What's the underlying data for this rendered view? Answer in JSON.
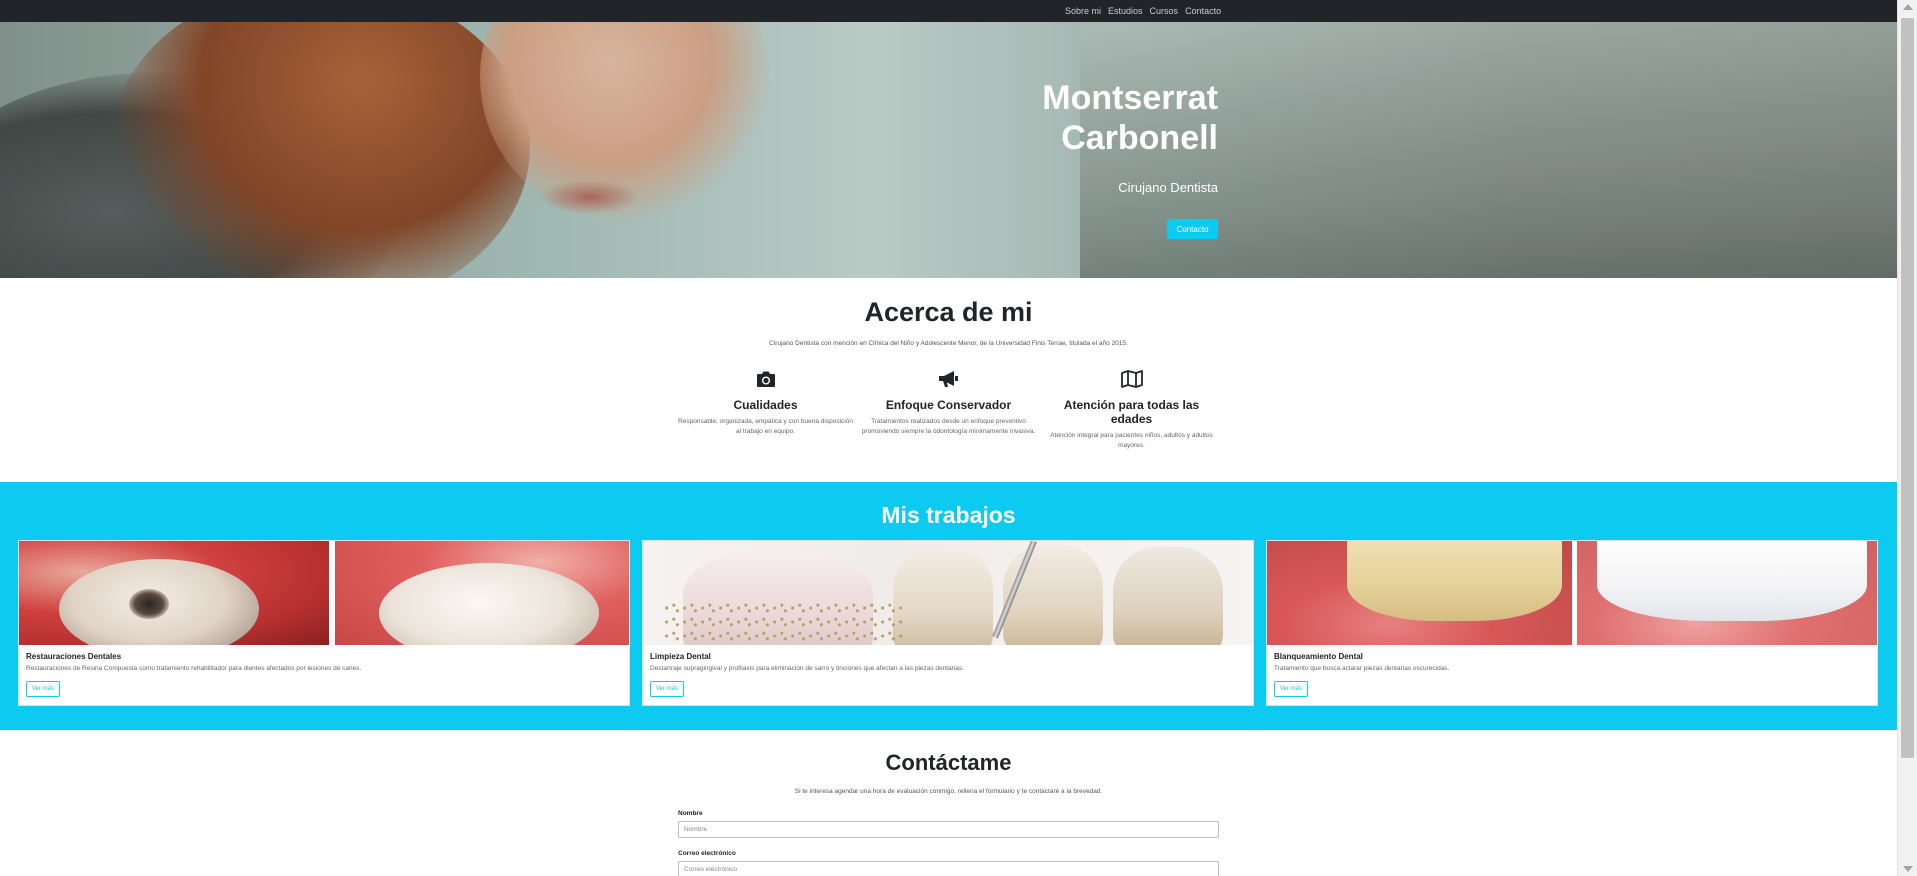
{
  "nav": {
    "items": [
      {
        "label": "Sobre mi"
      },
      {
        "label": "Estudios"
      },
      {
        "label": "Cursos"
      },
      {
        "label": "Contacto"
      }
    ]
  },
  "hero": {
    "name_line1": "Montserrat",
    "name_line2": "Carbonell",
    "role": "Cirujano Dentista",
    "button": "Contacto"
  },
  "about": {
    "title": "Acerca de mi",
    "intro": "Cirujano Dentista con mención en Clínica del Niño y Adolescente Menor, de la Universidad Finis Terrae, titulada el año 2015.",
    "features": [
      {
        "icon": "camera-icon",
        "title": "Cualidades",
        "text": "Responsable, organizada, empática y con buena disposición al trabajo en equipo."
      },
      {
        "icon": "megaphone-icon",
        "title": "Enfoque Conservador",
        "text": "Tratamientos realizados desde un enfoque preventivo promoviendo siempre la odontología mínimamente invasiva."
      },
      {
        "icon": "map-icon",
        "title": "Atención para todas las edades",
        "text": "Atención integral para pacientes niños, adultos y adultos mayores."
      }
    ]
  },
  "works": {
    "title": "Mis trabajos",
    "cards": [
      {
        "title": "Restauraciones Dentales",
        "text": "Restauraciones de Resina Compuesta como tratamiento rehabilitador para dientes afectados por lesiones de caries.",
        "button": "Ver más"
      },
      {
        "title": "Limpieza Dental",
        "text": "Destartraje supragingival y profilaxis para eliminación de sarro y tinciones que afectan a las piezas dentarias.",
        "button": "Ver más"
      },
      {
        "title": "Blanqueamiento Dental",
        "text": "Tratamiento que busca aclarar piezas dentarias oscurecidas.",
        "button": "Ver más"
      }
    ]
  },
  "contact": {
    "title": "Contáctame",
    "intro": "Si te interesa agendar una hora de evaluación conmigo, rellena el formulario y te contactaré a la brevedad.",
    "name_label": "Nombre",
    "name_placeholder": "Nombre",
    "email_label": "Correo electrónico",
    "email_placeholder": "Correo electrónico"
  },
  "colors": {
    "accent": "#0dcaf0",
    "navbar": "#212529",
    "text": "#212529"
  }
}
